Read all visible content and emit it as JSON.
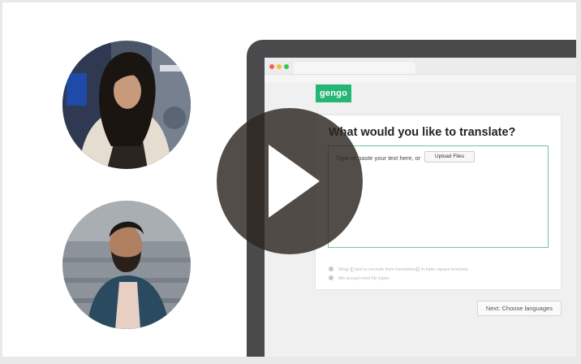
{
  "brand": {
    "logo_text": "gengo",
    "accent": "#26b574"
  },
  "browser": {
    "dots": [
      "#f0625a",
      "#f7be33",
      "#35c749"
    ]
  },
  "translate_form": {
    "title": "What would you like to translate?",
    "placeholder": "Type or paste your text here, or",
    "upload_label": "Upload Files",
    "hints": [
      "Wrap [[[ text to exclude from translation]]] in triple square brackets",
      "We accept most file types"
    ],
    "next_label": "Next: Choose languages"
  },
  "video": {
    "play_icon": "play-icon"
  }
}
